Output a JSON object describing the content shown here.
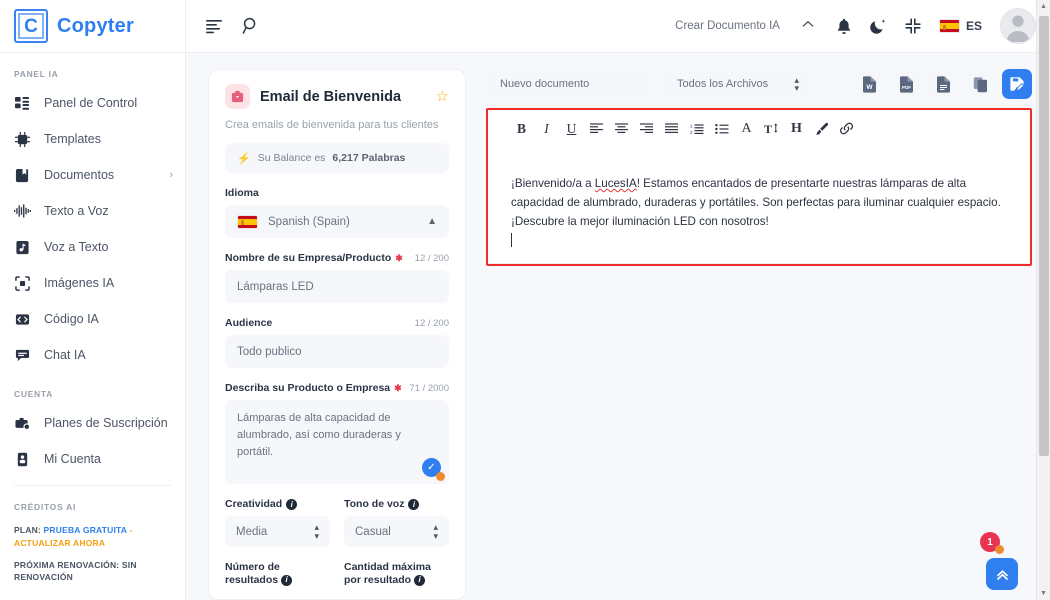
{
  "brand": {
    "mark": "C",
    "name": "Copyter"
  },
  "sidebar": {
    "section_panel": "PANEL IA",
    "items": [
      {
        "label": "Panel de Control",
        "icon": "dashboard-icon"
      },
      {
        "label": "Templates",
        "icon": "chip-icon"
      },
      {
        "label": "Documentos",
        "icon": "book-icon",
        "caret": "›"
      },
      {
        "label": "Texto a Voz",
        "icon": "waveform-icon"
      },
      {
        "label": "Voz a Texto",
        "icon": "audio-file-icon"
      },
      {
        "label": "Imágenes IA",
        "icon": "image-ai-icon"
      },
      {
        "label": "Código IA",
        "icon": "code-icon"
      },
      {
        "label": "Chat IA",
        "icon": "chat-icon"
      }
    ],
    "section_account": "CUENTA",
    "account_items": [
      {
        "label": "Planes de Suscripción",
        "icon": "briefcase-icon"
      },
      {
        "label": "Mi Cuenta",
        "icon": "id-card-icon"
      }
    ],
    "section_credits": "CRÉDITOS AI",
    "plan_prefix": "PLAN:",
    "plan_value": "PRUEBA GRATUITA",
    "plan_sep": "-",
    "plan_action": "ACTUALIZAR AHORA",
    "renewal": "PRÓXIMA RENOVACIÓN: SIN RENOVACIÓN"
  },
  "topbar": {
    "menu_icon": "menu-icon",
    "search_icon": "search-icon",
    "create_label": "Crear Documento IA",
    "caret": "⌃",
    "bell_icon": "bell-icon",
    "theme_icon": "moon-icon",
    "fullscreen_icon": "compress-icon",
    "lang_code": "ES",
    "avatar": "user-avatar"
  },
  "form": {
    "title": "Email de Bienvenida",
    "badge_icon": "mail-template-icon",
    "star_icon": "star-icon",
    "subtitle": "Crea emails de bienvenida para tus clientes",
    "balance_text_pre": "Su Balance es",
    "balance_value": "6,217 Palabras",
    "language_label": "Idioma",
    "language_value": "Spanish (Spain)",
    "fields": [
      {
        "label": "Nombre de su Empresa/Producto",
        "required": true,
        "counter": "12 / 200",
        "value": "Lámparas LED"
      },
      {
        "label": "Audience",
        "required": false,
        "counter": "12 / 200",
        "value": "Todo publico"
      }
    ],
    "description_label": "Describa su Producto o Empresa",
    "description_counter": "71 / 2000",
    "description_value": "Lámparas de alta capacidad de alumbrado, así como duraderas y portátil.",
    "creativity_label": "Creatividad",
    "creativity_value": "Media",
    "tone_label": "Tono de voz",
    "tone_value": "Casual",
    "results_label": "Número de resultados",
    "max_per_result_label": "Cantidad máxima por resultado"
  },
  "document": {
    "new_doc_label": "Nuevo documento",
    "filter_label": "Todos los Archivos",
    "export_buttons": [
      {
        "name": "export-word-button",
        "label": "W"
      },
      {
        "name": "export-pdf-button",
        "label": "PDF"
      },
      {
        "name": "export-text-button",
        "label": "TXT"
      },
      {
        "name": "copy-button",
        "label": "COPY"
      },
      {
        "name": "save-document-button",
        "label": "SAVE"
      }
    ],
    "toolbar": [
      {
        "name": "bold-icon",
        "glyph": "B"
      },
      {
        "name": "italic-icon",
        "glyph": "I"
      },
      {
        "name": "underline-icon",
        "glyph": "U"
      },
      {
        "name": "align-left-icon",
        "glyph": ""
      },
      {
        "name": "align-center-icon",
        "glyph": ""
      },
      {
        "name": "align-right-icon",
        "glyph": ""
      },
      {
        "name": "align-justify-icon",
        "glyph": ""
      },
      {
        "name": "ordered-list-icon",
        "glyph": ""
      },
      {
        "name": "unordered-list-icon",
        "glyph": ""
      },
      {
        "name": "font-family-icon",
        "glyph": "A"
      },
      {
        "name": "font-size-icon",
        "glyph": "T"
      },
      {
        "name": "heading-icon",
        "glyph": "H"
      },
      {
        "name": "highlight-brush-icon",
        "glyph": ""
      },
      {
        "name": "link-icon",
        "glyph": ""
      }
    ],
    "body_part1": "¡Bienvenido/a a ",
    "body_misspelled": "LucesIA",
    "body_part2": "! Estamos encantados de presentarte nuestras lámparas de alta capacidad de alumbrado, duraderas y portátiles. Son perfectas para iluminar cualquier espacio. ¡Descubre la mejor iluminación LED con nosotros!"
  },
  "floating": {
    "notification_count": "1",
    "scroll_top_icon": "double-chevron-up-icon"
  },
  "colors": {
    "accent": "#2f7ff0",
    "danger": "#e8344e",
    "warning": "#f28b30",
    "highlight_box": "#ef2b2b"
  }
}
